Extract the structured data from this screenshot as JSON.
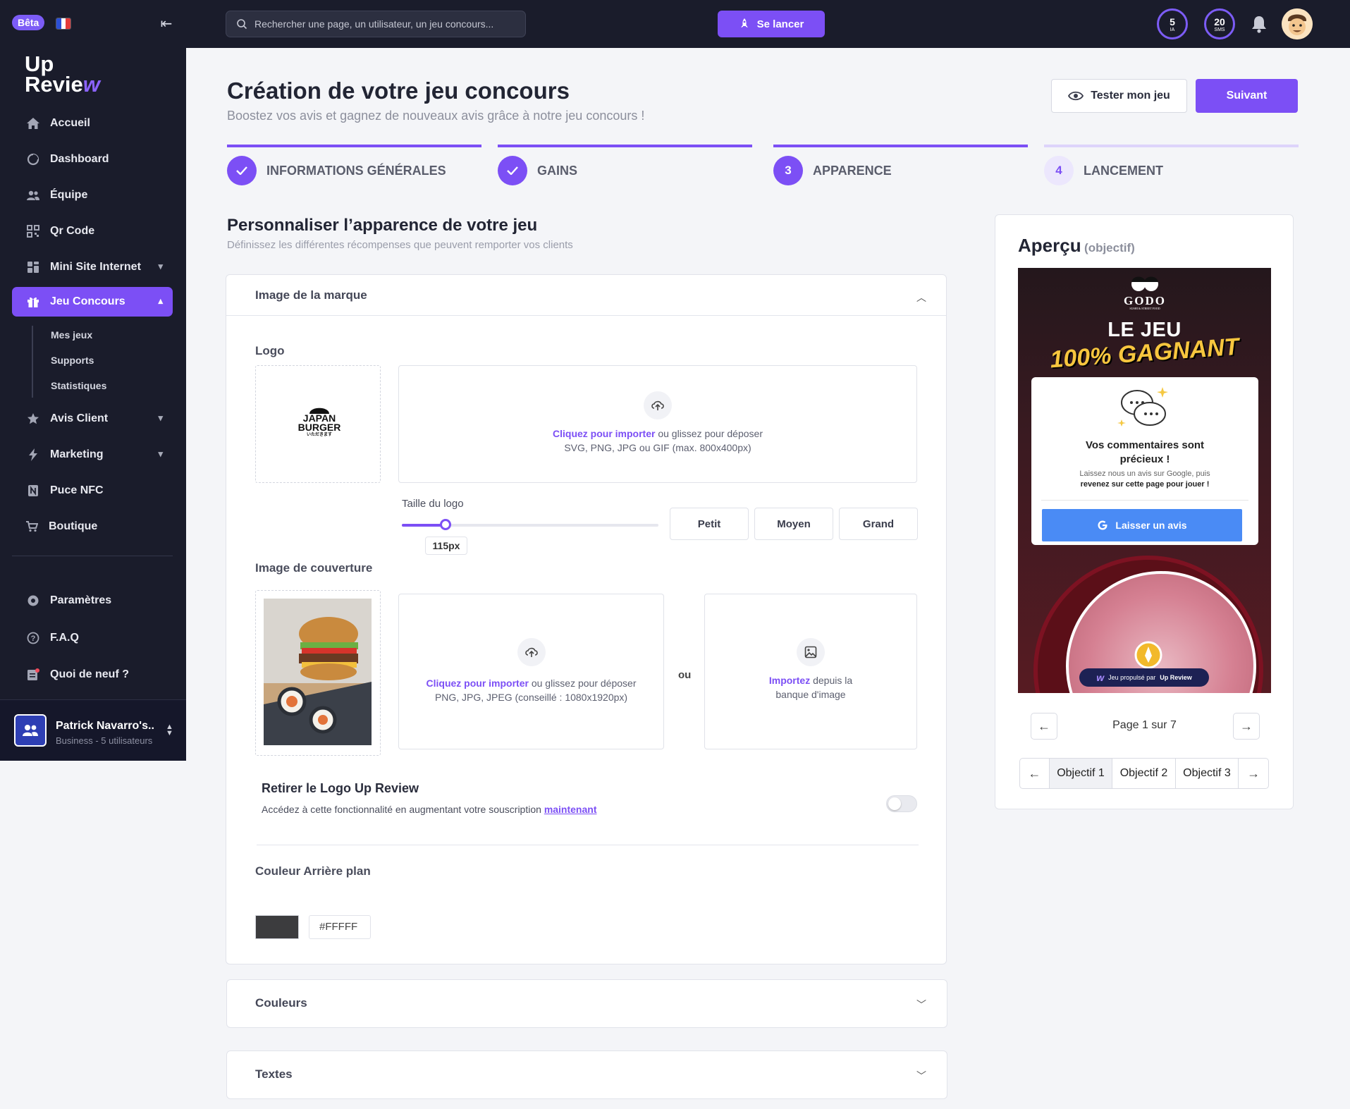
{
  "topbar": {
    "beta_label": "Bêta",
    "search_placeholder": "Rechercher une page, un utilisateur, un jeu concours...",
    "launch_label": "Se lancer",
    "counters": [
      {
        "value": "5",
        "label": "IA"
      },
      {
        "value": "20",
        "label": "SMS"
      }
    ]
  },
  "brand": {
    "line1": "Up",
    "line2": "Revie",
    "accent": "w"
  },
  "sidebar": {
    "items": [
      {
        "label": "Accueil",
        "icon": "home-icon"
      },
      {
        "label": "Dashboard",
        "icon": "dashboard-icon"
      },
      {
        "label": "Équipe",
        "icon": "team-icon"
      },
      {
        "label": "Qr Code",
        "icon": "qrcode-icon"
      },
      {
        "label": "Mini Site Internet",
        "icon": "website-icon"
      },
      {
        "label": "Jeu Concours",
        "icon": "gift-icon"
      },
      {
        "label": "Avis Client",
        "icon": "star-icon"
      },
      {
        "label": "Marketing",
        "icon": "bolt-icon"
      },
      {
        "label": "Puce NFC",
        "icon": "nfc-icon"
      },
      {
        "label": "Boutique",
        "icon": "cart-icon"
      }
    ],
    "sub_items": [
      "Mes jeux",
      "Supports",
      "Statistiques"
    ],
    "bottom_items": [
      {
        "label": "Paramètres",
        "icon": "settings-icon"
      },
      {
        "label": "F.A.Q",
        "icon": "help-icon"
      },
      {
        "label": "Quoi de neuf ?",
        "icon": "news-icon"
      }
    ],
    "user": {
      "name": "Patrick Navarro's..",
      "plan": "Business - 5 utilisateurs"
    }
  },
  "page": {
    "title": "Création de votre jeu concours",
    "subtitle": "Boostez vos avis et gagnez de nouveaux avis grâce à notre jeu concours !",
    "test_button": "Tester mon jeu",
    "next_button": "Suivant"
  },
  "steps": [
    {
      "number": "",
      "label": "INFORMATIONS GÉNÉRALES",
      "state": "done"
    },
    {
      "number": "",
      "label": "GAINS",
      "state": "done"
    },
    {
      "number": "3",
      "label": "APPARENCE",
      "state": "current"
    },
    {
      "number": "4",
      "label": "LANCEMENT",
      "state": "todo"
    }
  ],
  "section": {
    "title": "Personnaliser l’apparence de votre jeu",
    "subtitle": "Définissez les différentes récompenses que peuvent remporter vos clients"
  },
  "brand_card": {
    "title": "Image de la marque",
    "logo_label": "Logo",
    "logo_text_1": "JAPAN",
    "logo_text_2": "BURGER",
    "logo_text_3": "いただきます",
    "upload_link": "Cliquez pour importer",
    "upload_rest": " ou glissez pour déposer",
    "logo_formats": "SVG, PNG, JPG ou GIF (max. 800x400px)",
    "size_label": "Taille du logo",
    "size_value": "115px",
    "size_fraction": 0.17,
    "size_options": [
      "Petit",
      "Moyen",
      "Grand"
    ],
    "cover_label": "Image de couverture",
    "cover_formats": "PNG, JPG, JPEG (conseillé : 1080x1920px)",
    "or_label": "ou",
    "bank_link": "Importez",
    "bank_rest": " depuis la banque d'image",
    "remove_logo_title": "Retirer le Logo Up Review",
    "remove_logo_desc": "Accédez à cette fonctionnalité en augmentant votre souscription ",
    "remove_logo_link": "maintenant",
    "remove_logo_enabled": false,
    "bg_color_label": "Couleur Arrière plan",
    "bg_color_value": "#FFFFF",
    "bg_swatch_color": "#3c3c3e"
  },
  "collapsed_cards": [
    "Couleurs",
    "Textes"
  ],
  "preview": {
    "title": "Aperçu",
    "title_note": "(objectif)",
    "godo": "GODO",
    "godo_tag": "SUSHI & STREET FOOD",
    "headline_1": "LE JEU",
    "headline_2": "100% GAGNANT",
    "modal_title_1": "Vos commentaires sont",
    "modal_title_2": "précieux !",
    "modal_desc_1": "Laissez nous un avis sur Google, puis",
    "modal_desc_2": "revenez sur cette page pour jouer !",
    "modal_button": "Laisser un avis",
    "powered_by": "Jeu propulsé par",
    "powered_brand": "Up Review",
    "page_text": "Page 1 sur 7",
    "objectives": [
      "Objectif 1",
      "Objectif 2",
      "Objectif 3"
    ]
  },
  "colors": {
    "accent": "#7c4ff5",
    "sidebar_bg": "#1a1c2b",
    "google_blue": "#4a8bf5"
  }
}
